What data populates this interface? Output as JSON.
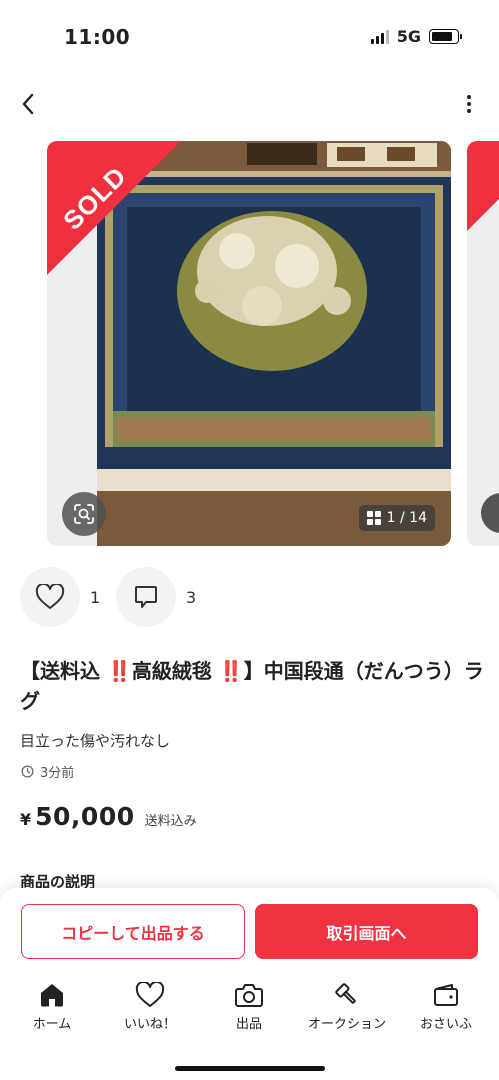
{
  "status_bar": {
    "time": "11:00",
    "network": "5G"
  },
  "gallery": {
    "sold_label": "SOLD",
    "counter": "1 / 14"
  },
  "engagement": {
    "likes": "1",
    "comments": "3"
  },
  "item": {
    "title": "【送料込 ‼️高級絨毯 ‼️】中国段通（だんつう）ラグ",
    "condition": "目立った傷や汚れなし",
    "posted": "3分前",
    "price_symbol": "¥",
    "price": "50,000",
    "shipping_note": "送料込み"
  },
  "description": {
    "heading": "商品の説明"
  },
  "actions": {
    "copy_label": "コピーして出品する",
    "trade_label": "取引画面へ"
  },
  "tabs": [
    {
      "label": "ホーム",
      "icon": "home-icon"
    },
    {
      "label": "いいね！",
      "icon": "heart-icon"
    },
    {
      "label": "出品",
      "icon": "camera-icon"
    },
    {
      "label": "オークション",
      "icon": "gavel-icon"
    },
    {
      "label": "おさいふ",
      "icon": "wallet-icon"
    }
  ],
  "colors": {
    "accent": "#ef3340",
    "sold_ribbon": "#f0303f"
  }
}
